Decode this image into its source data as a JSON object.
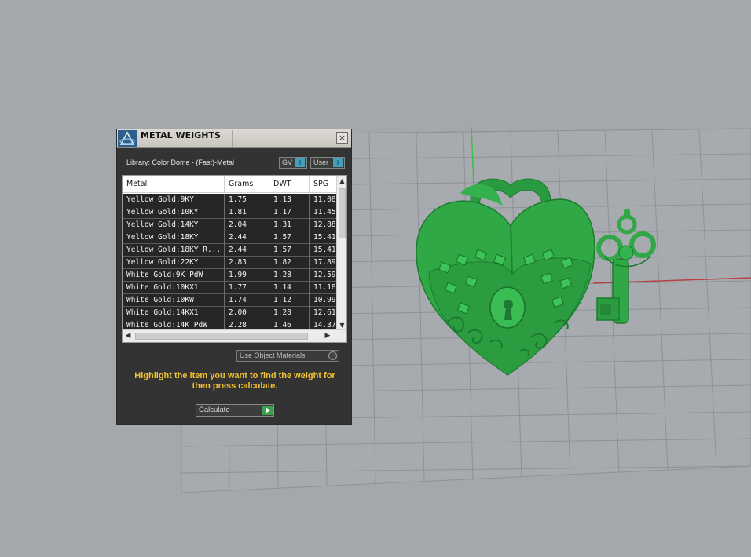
{
  "dialog": {
    "title": "METAL WEIGHTS",
    "close_label": "×",
    "library_label": "Library: Color Dome - (Fast)-Metal",
    "toggle_gv": "GV",
    "toggle_user": "User",
    "toggle_knob": "I",
    "table": {
      "columns": [
        "Metal",
        "Grams",
        "DWT",
        "SPG"
      ],
      "rows": [
        {
          "metal": "Yellow Gold:9KY",
          "grams": "1.75",
          "dwt": "1.13",
          "spg": "11.08"
        },
        {
          "metal": "Yellow Gold:10KY",
          "grams": "1.81",
          "dwt": "1.17",
          "spg": "11.45"
        },
        {
          "metal": "Yellow Gold:14KY",
          "grams": "2.04",
          "dwt": "1.31",
          "spg": "12.88"
        },
        {
          "metal": "Yellow Gold:18KY",
          "grams": "2.44",
          "dwt": "1.57",
          "spg": "15.41"
        },
        {
          "metal": "Yellow Gold:18KY R...",
          "grams": "2.44",
          "dwt": "1.57",
          "spg": "15.41"
        },
        {
          "metal": "Yellow Gold:22KY",
          "grams": "2.83",
          "dwt": "1.82",
          "spg": "17.89"
        },
        {
          "metal": "White Gold:9K PdW",
          "grams": "1.99",
          "dwt": "1.28",
          "spg": "12.59"
        },
        {
          "metal": "White Gold:10KX1",
          "grams": "1.77",
          "dwt": "1.14",
          "spg": "11.18"
        },
        {
          "metal": "White Gold:10KW",
          "grams": "1.74",
          "dwt": "1.12",
          "spg": "10.99"
        },
        {
          "metal": "White Gold:14KX1",
          "grams": "2.00",
          "dwt": "1.28",
          "spg": "12.61"
        },
        {
          "metal": "White Gold:14K PdW",
          "grams": "2.28",
          "dwt": "1.46",
          "spg": "14.37"
        }
      ]
    },
    "use_object_materials": "Use Object Materials",
    "instructions": "Highlight the item you want to find the weight for then press calculate.",
    "calculate_label": "Calculate"
  },
  "colors": {
    "viewport_bg": "#a4a8ad",
    "model_green": "#2fa845",
    "axis_red": "#b84040",
    "axis_green": "#3cbf4a",
    "instruction_text": "#f1c232"
  },
  "icons": {
    "app_logo": "app-logo-icon",
    "close": "close-icon",
    "calculate_play": "play-icon"
  }
}
